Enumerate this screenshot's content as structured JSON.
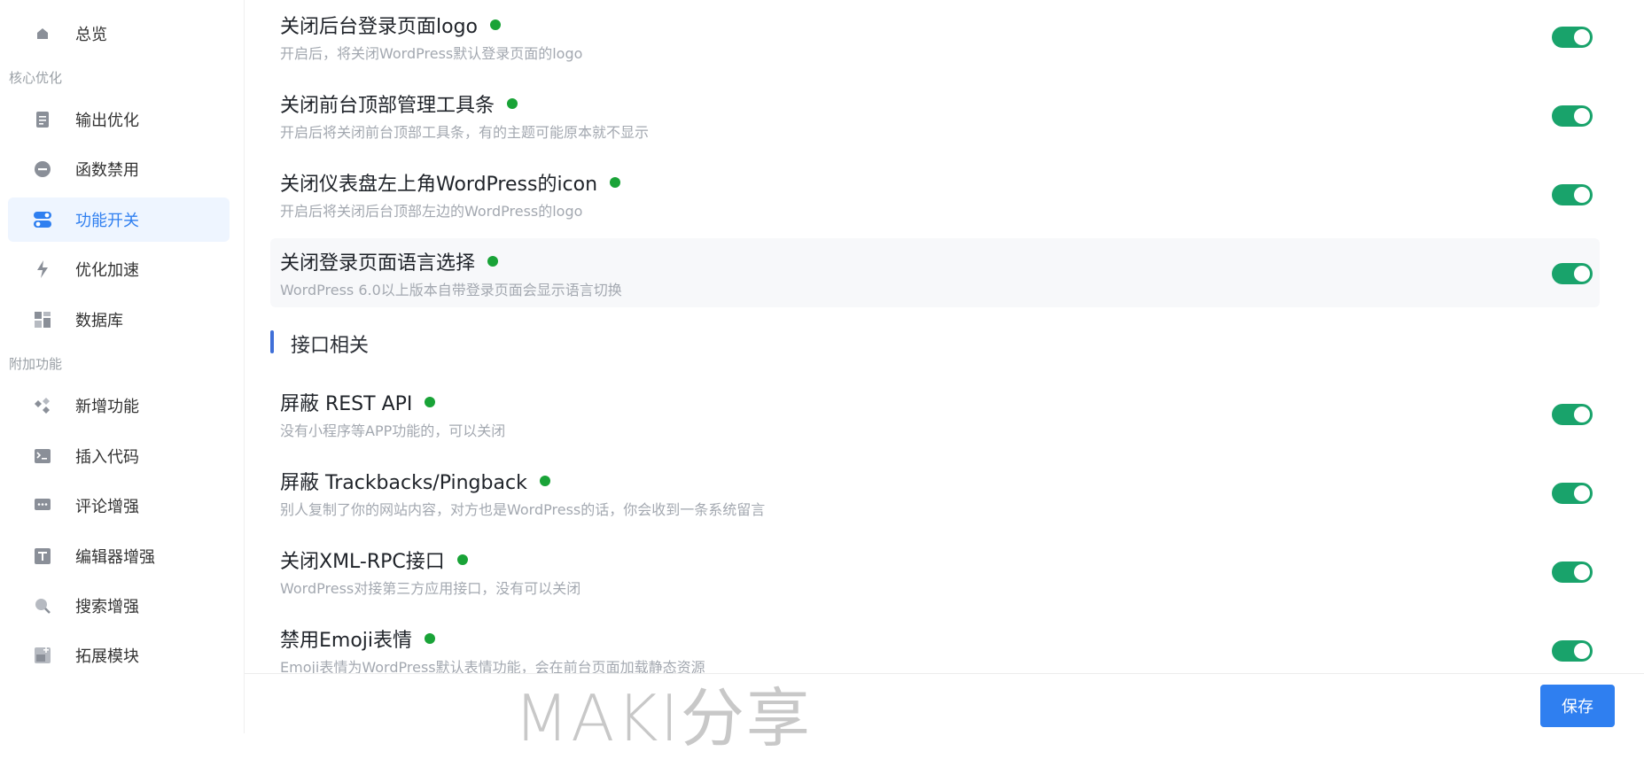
{
  "sidebar": {
    "overview": "总览",
    "group_core": "核心优化",
    "items_core": [
      {
        "label": "输出优化",
        "icon": "document-icon"
      },
      {
        "label": "函数禁用",
        "icon": "minus-circle-icon"
      },
      {
        "label": "功能开关",
        "icon": "toggle-switches-icon"
      },
      {
        "label": "优化加速",
        "icon": "lightning-icon"
      },
      {
        "label": "数据库",
        "icon": "grid-icon"
      }
    ],
    "group_extra": "附加功能",
    "items_extra": [
      {
        "label": "新增功能",
        "icon": "diamonds-icon"
      },
      {
        "label": "插入代码",
        "icon": "terminal-icon"
      },
      {
        "label": "评论增强",
        "icon": "comment-icon"
      },
      {
        "label": "编辑器增强",
        "icon": "text-t-icon"
      },
      {
        "label": "搜索增强",
        "icon": "search-icon"
      },
      {
        "label": "拓展模块",
        "icon": "plus-document-icon"
      }
    ]
  },
  "settings_top": [
    {
      "title": "关闭后台登录页面logo",
      "desc": "开启后，将关闭WordPress默认登录页面的logo",
      "enabled": true
    },
    {
      "title": "关闭前台顶部管理工具条",
      "desc": "开启后将关闭前台顶部工具条，有的主题可能原本就不显示",
      "enabled": true
    },
    {
      "title": "关闭仪表盘左上角WordPress的icon",
      "desc": "开启后将关闭后台顶部左边的WordPress的logo",
      "enabled": true
    },
    {
      "title": "关闭登录页面语言选择",
      "desc": "WordPress 6.0以上版本自带登录页面会显示语言切换",
      "enabled": true
    }
  ],
  "section_api": "接口相关",
  "settings_api": [
    {
      "title": "屏蔽 REST API",
      "desc": "没有小程序等APP功能的，可以关闭",
      "enabled": true
    },
    {
      "title": "屏蔽 Trackbacks/Pingback",
      "desc": "别人复制了你的网站内容，对方也是WordPress的话，你会收到一条系统留言",
      "enabled": true
    },
    {
      "title": "关闭XML-RPC接口",
      "desc": "WordPress对接第三方应用接口，没有可以关闭",
      "enabled": true
    },
    {
      "title": "禁用Emoji表情",
      "desc": "Emoji表情为WordPress默认表情功能，会在前台页面加载静态资源",
      "enabled": true
    }
  ],
  "footer": {
    "watermark": "MAKI分享",
    "save_label": "保存"
  },
  "colors": {
    "accent": "#2f7ff0",
    "toggle_on": "#19a36b",
    "status_dot": "#19a337",
    "active_nav_bg": "#eef5ff"
  }
}
